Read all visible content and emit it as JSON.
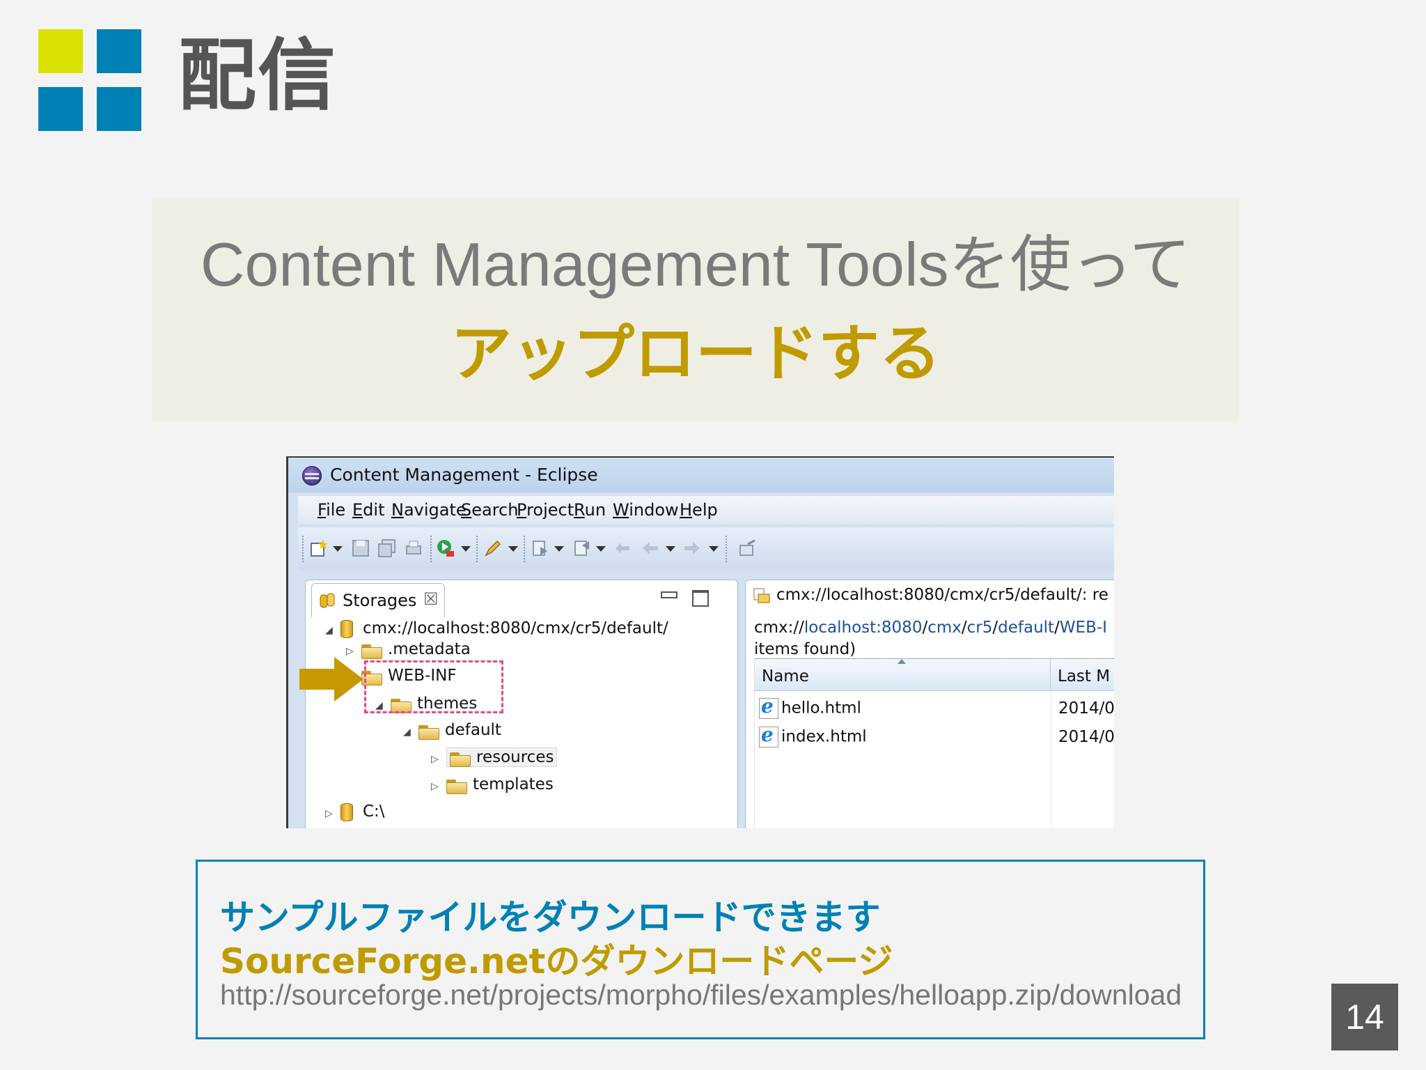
{
  "slide": {
    "title": "配信",
    "headline_line1": "Content Management Toolsを使って",
    "headline_line2": "アップロードする",
    "page_number": "14",
    "colors": {
      "accent_blue": "#0081b4",
      "accent_yellow": "#d9e100",
      "accent_gold": "#c09b00"
    }
  },
  "eclipse": {
    "window_title": "Content Management - Eclipse",
    "menu": [
      "File",
      "Edit",
      "Navigate",
      "Search",
      "Project",
      "Run",
      "Window",
      "Help"
    ],
    "toolbar_icons": [
      "new-wizard-icon",
      "save-icon",
      "save-all-icon",
      "print-icon",
      "run-icon",
      "pencil-icon",
      "next-annotation-icon",
      "prev-annotation-icon",
      "back-icon",
      "forward-icon",
      "pin-icon"
    ],
    "storages_view": {
      "tab_label": "Storages",
      "tree": [
        {
          "label": "cmx://localhost:8080/cmx/cr5/default/",
          "toggle": "◢"
        },
        {
          "label": ".metadata",
          "toggle": "▷"
        },
        {
          "label": "WEB-INF",
          "toggle": "◢"
        },
        {
          "label": "themes",
          "toggle": "◢"
        },
        {
          "label": "default",
          "toggle": "◢"
        },
        {
          "label": "resources",
          "toggle": "▷"
        },
        {
          "label": "templates",
          "toggle": "▷"
        },
        {
          "label": "C:\\",
          "toggle": "▷"
        }
      ]
    },
    "content_view": {
      "header": "cmx://localhost:8080/cmx/cr5/default/: re",
      "path_prefix": "cmx://",
      "path_host": "localhost:8080",
      "path_sep1": "/",
      "path_cmx": "cmx",
      "path_sep2": "/",
      "path_cr5": "cr5",
      "path_sep3": "/",
      "path_default": "default",
      "path_sep4": "/",
      "path_webinf": "WEB-I",
      "items_found": "items found)",
      "columns": [
        "Name",
        "Last M"
      ],
      "rows": [
        {
          "name": "hello.html",
          "modified": "2014/0"
        },
        {
          "name": "index.html",
          "modified": "2014/0"
        }
      ]
    }
  },
  "info": {
    "line1": "サンプルファイルをダウンロードできます",
    "line2": "SourceForge.netのダウンロードページ",
    "url": "http://sourceforge.net/projects/morpho/files/examples/helloapp.zip/download"
  }
}
